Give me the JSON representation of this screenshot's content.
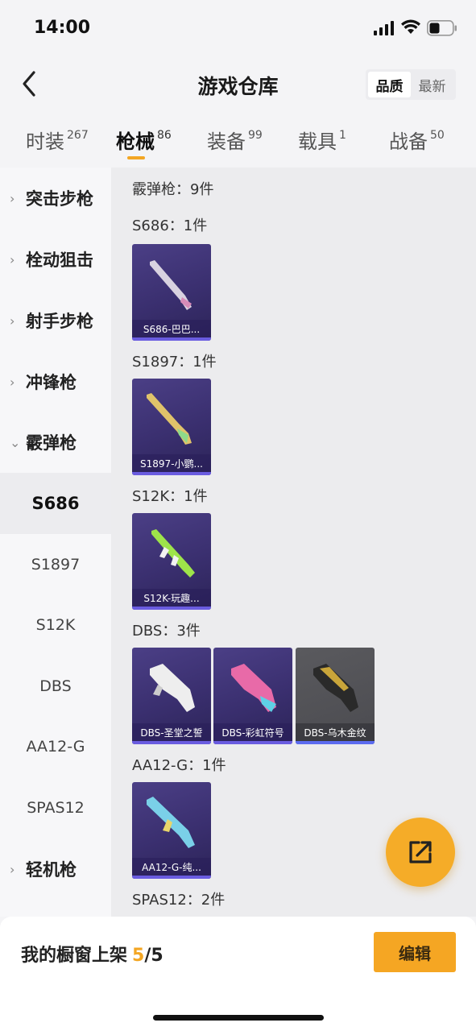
{
  "status": {
    "time": "14:00"
  },
  "header": {
    "title": "游戏仓库",
    "sort_options": [
      "品质",
      "最新"
    ],
    "sort_active": "品质"
  },
  "tabs": [
    {
      "label": "时装",
      "count": "267"
    },
    {
      "label": "枪械",
      "count": "86"
    },
    {
      "label": "装备",
      "count": "99"
    },
    {
      "label": "载具",
      "count": "1"
    },
    {
      "label": "战备",
      "count": "50"
    }
  ],
  "sidebar": {
    "categories": [
      "突击步枪",
      "栓动狙击",
      "射手步枪",
      "冲锋枪",
      "霰弹枪"
    ],
    "subitems": [
      "S686",
      "S1897",
      "S12K",
      "DBS",
      "AA12-G",
      "SPAS12"
    ],
    "bottom_category": "轻机枪"
  },
  "content": {
    "section_title": "霰弹枪：9件",
    "groups": [
      {
        "title": "S686：1件",
        "items": [
          {
            "name": "S686-巴巴...",
            "quality": "purple",
            "color": "#d8d2e0"
          }
        ]
      },
      {
        "title": "S1897：1件",
        "items": [
          {
            "name": "S1897-小鹦...",
            "quality": "purple",
            "color": "#e0c36a"
          }
        ]
      },
      {
        "title": "S12K：1件",
        "items": [
          {
            "name": "S12K-玩趣...",
            "quality": "purple",
            "color": "#9ee44a"
          }
        ]
      },
      {
        "title": "DBS：3件",
        "items": [
          {
            "name": "DBS-圣堂之誓",
            "quality": "purple",
            "color": "#eeeeee"
          },
          {
            "name": "DBS-彩虹符号",
            "quality": "purple",
            "color": "#e86aa8"
          },
          {
            "name": "DBS-乌木金纹",
            "quality": "gray",
            "color": "#c9a53a"
          }
        ]
      },
      {
        "title": "AA12-G：1件",
        "items": [
          {
            "name": "AA12-G-纯...",
            "quality": "purple",
            "color": "#7ad0e8"
          }
        ]
      },
      {
        "title": "SPAS12：2件",
        "items": []
      }
    ]
  },
  "bottom": {
    "label": "我的橱窗上架",
    "current": "5",
    "total": "/5",
    "edit_label": "编辑"
  },
  "colors": {
    "accent": "#f3a623",
    "card_purple": "#3e3377",
    "card_gray": "#505055"
  }
}
